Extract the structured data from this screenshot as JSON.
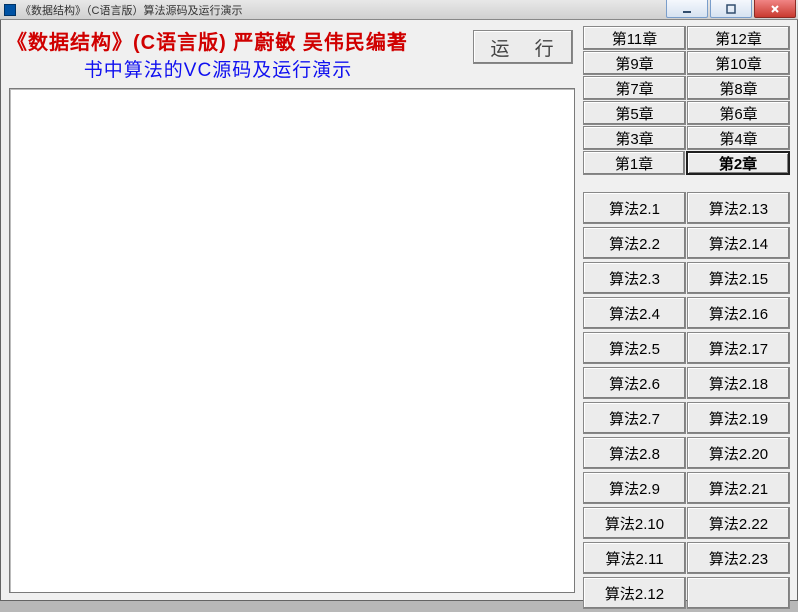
{
  "window": {
    "title": "《数据结构》（C语言版）算法源码及运行演示"
  },
  "header": {
    "line1": "《数据结构》(C语言版)  严蔚敏  吴伟民编著",
    "line2": "书中算法的VC源码及运行演示",
    "run_label": "运 行"
  },
  "chapters": {
    "rows": [
      [
        "第11章",
        "第12章"
      ],
      [
        "第9章",
        "第10章"
      ],
      [
        "第7章",
        "第8章"
      ],
      [
        "第5章",
        "第6章"
      ],
      [
        "第3章",
        "第4章"
      ],
      [
        "第1章",
        "第2章"
      ]
    ],
    "selected": "第2章"
  },
  "algorithms": {
    "left": [
      "算法2.1",
      "算法2.2",
      "算法2.3",
      "算法2.4",
      "算法2.5",
      "算法2.6",
      "算法2.7",
      "算法2.8",
      "算法2.9",
      "算法2.10",
      "算法2.11",
      "算法2.12"
    ],
    "right": [
      "算法2.13",
      "算法2.14",
      "算法2.15",
      "算法2.16",
      "算法2.17",
      "算法2.18",
      "算法2.19",
      "算法2.20",
      "算法2.21",
      "算法2.22",
      "算法2.23",
      ""
    ]
  }
}
